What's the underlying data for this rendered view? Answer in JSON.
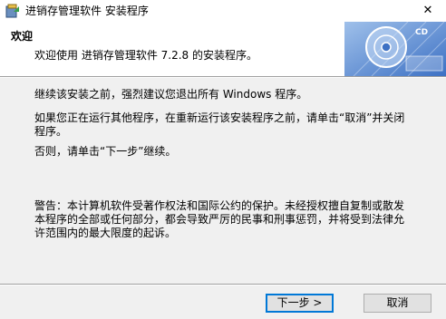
{
  "window": {
    "title": "进销存管理软件 安装程序",
    "close_glyph": "✕"
  },
  "header": {
    "title": "欢迎",
    "subtitle": "欢迎使用 进销存管理软件 7.2.8 的安装程序。",
    "graphic_label": "CD"
  },
  "body": {
    "p1": "继续该安装之前，强烈建议您退出所有 Windows 程序。",
    "p2": "如果您正在运行其他程序，在重新运行该安装程序之前，请单击“取消”并关闭程序。",
    "p3": "否则，请单击“下一步”继续。",
    "p4": "警告：本计算机软件受著作权法和国际公约的保护。未经授权擅自复制或散发本程序的全部或任何部分，都会导致严厉的民事和刑事惩罚，并将受到法律允许范围内的最大限度的起诉。"
  },
  "buttons": {
    "next": "下一步 >",
    "cancel": "取消"
  },
  "colors": {
    "accent": "#0078d7",
    "header_graphic": "#5b8fd6"
  }
}
